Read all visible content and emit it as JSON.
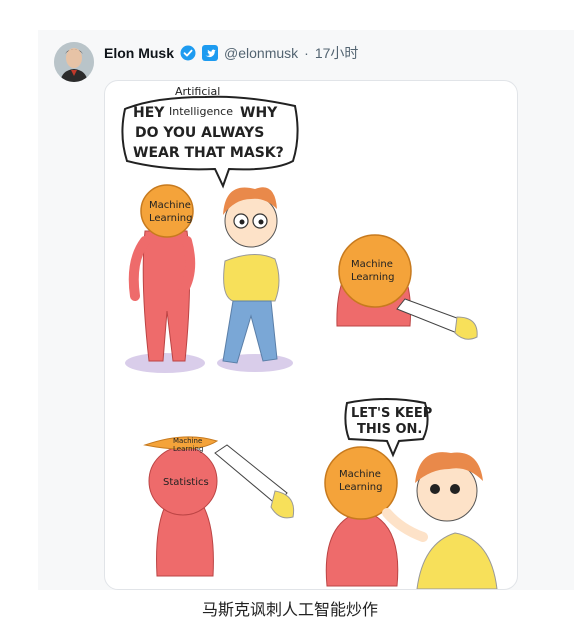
{
  "tweet": {
    "author_name": "Elon Musk",
    "handle": "@elonmusk",
    "separator": "·",
    "time": "17小时"
  },
  "comic": {
    "bubble1_small": "Artificial",
    "bubble1_line1_a": "HEY",
    "bubble1_line1_b": "Intelligence",
    "bubble1_line1_c": "WHY",
    "bubble1_line2": "DO YOU ALWAYS",
    "bubble1_line3": "WEAR THAT MASK?",
    "mask_label_1": "Machine",
    "mask_label_2": "Learning",
    "statistics_label": "Statistics",
    "bubble2_line1": "LET'S KEEP",
    "bubble2_line2": "THIS ON."
  },
  "caption": "马斯克讽刺人工智能炒作",
  "colors": {
    "verified_blue": "#1d9bf0",
    "link_blue": "#1d9bf0",
    "mask_orange": "#f4a33a",
    "body_red": "#ee6b6b",
    "shirt_yellow": "#f7e05a",
    "pants_blue": "#7aa7d6",
    "hair_orange": "#e9894a"
  }
}
